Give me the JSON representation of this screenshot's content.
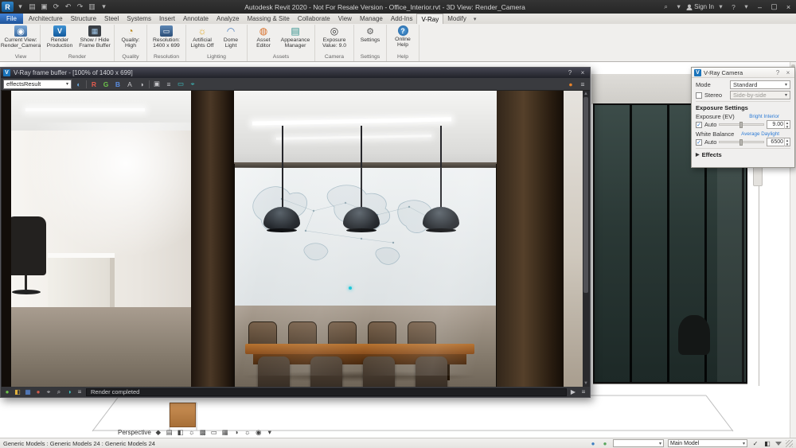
{
  "titlebar": {
    "title": "Autodesk Revit 2020 - Not For Resale Version - Office_Interior.rvt - 3D View: Render_Camera",
    "sign_in": "Sign In"
  },
  "tabs": [
    "File",
    "Architecture",
    "Structure",
    "Steel",
    "Systems",
    "Insert",
    "Annotate",
    "Analyze",
    "Massing & Site",
    "Collaborate",
    "View",
    "Manage",
    "Add-Ins",
    "V-Ray",
    "Modify"
  ],
  "ribbon": {
    "groups": [
      {
        "label": "View",
        "buttons": [
          "Current View: Render_Camera"
        ]
      },
      {
        "label": "Render",
        "buttons": [
          "Render Production",
          "Show / Hide Frame Buffer"
        ]
      },
      {
        "label": "Quality",
        "buttons": [
          "Quality: High"
        ]
      },
      {
        "label": "Resolution",
        "buttons": [
          "Resolution: 1400 x 699"
        ]
      },
      {
        "label": "Lighting",
        "buttons": [
          "Artificial Lights Off",
          "Dome Light"
        ]
      },
      {
        "label": "Assets",
        "buttons": [
          "Asset Editor",
          "Appearance Manager"
        ]
      },
      {
        "label": "Camera",
        "buttons": [
          "Exposure Value: 9.0"
        ]
      },
      {
        "label": "Settings",
        "buttons": [
          "Settings"
        ]
      },
      {
        "label": "Help",
        "buttons": [
          "Online Help"
        ]
      }
    ]
  },
  "vfb": {
    "title": "V-Ray frame buffer - [100% of 1400 x 699]",
    "channel": "effectsResult",
    "status": "Render completed"
  },
  "camera_panel": {
    "title": "V-Ray Camera",
    "mode_label": "Mode",
    "mode_value": "Standard",
    "stereo_label": "Stereo",
    "stereo_value": "Side-by-side",
    "exposure_header": "Exposure Settings",
    "exposure_label": "Exposure (EV)",
    "exposure_hint": "Bright Interior",
    "auto_label": "Auto",
    "exposure_value": "9.00",
    "wb_label": "White Balance",
    "wb_hint": "Average Daylight",
    "wb_value": "6500",
    "effects_label": "Effects"
  },
  "viewbar": {
    "label": "Perspective"
  },
  "statusbar": {
    "left": "Generic Models : Generic Models 24 : Generic Models 24",
    "main_model": "Main Model"
  },
  "icons": {
    "revit": "R",
    "open": "▤",
    "save": "▣",
    "sync": "⟳",
    "undo": "↶",
    "redo": "↷",
    "print": "▥",
    "caret": "▾",
    "search": "⌕",
    "help": "?",
    "minimize": "–",
    "maximize": "▢",
    "close": "×",
    "camera": "◉",
    "vray": "V",
    "buffer": "▦",
    "gauge": "◔",
    "monitor": "▭",
    "bulb": "☼",
    "dome": "◠",
    "sphere": "◍",
    "palette": "▤",
    "aperture": "◎",
    "gear": "⚙",
    "question": "?",
    "globe": "◐",
    "red": "R",
    "green": "G",
    "blue": "B",
    "alpha": "A",
    "mono": "◑",
    "list": "≡",
    "region": "▭",
    "target": "⌖",
    "dot": "●",
    "grid": "▦",
    "check": "✓",
    "play": "▶",
    "sun": "☼",
    "shadow": "▩",
    "halfsq": "◧",
    "diamond": "◆",
    "wheel": "◉"
  },
  "colors": {
    "file_tab": "#2f6bbf",
    "vray_blue": "#1a74bb",
    "hint_blue": "#2e7cd6",
    "accent_cyan": "#17c6d8",
    "render_status_bg": "#1e1f22"
  }
}
